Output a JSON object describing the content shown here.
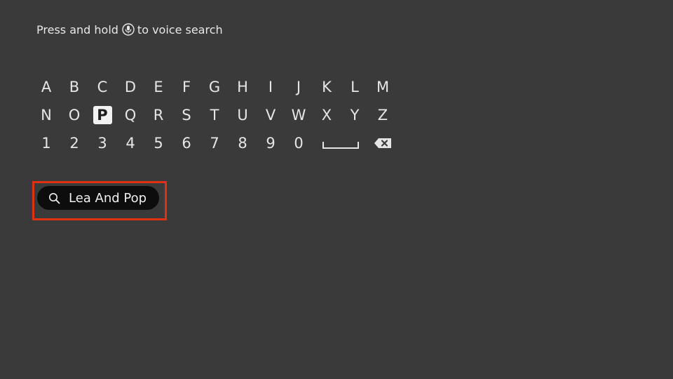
{
  "hint": {
    "prefix": "Press and hold",
    "icon": "microphone-icon",
    "suffix": "to voice search"
  },
  "keyboard": {
    "rows": [
      [
        "A",
        "B",
        "C",
        "D",
        "E",
        "F",
        "G",
        "H",
        "I",
        "J",
        "K",
        "L",
        "M"
      ],
      [
        "N",
        "O",
        "P",
        "Q",
        "R",
        "S",
        "T",
        "U",
        "V",
        "W",
        "X",
        "Y",
        "Z"
      ],
      [
        "1",
        "2",
        "3",
        "4",
        "5",
        "6",
        "7",
        "8",
        "9",
        "0"
      ]
    ],
    "selected_key": "P",
    "special_keys": [
      "space-icon",
      "backspace-icon"
    ]
  },
  "search": {
    "query": "Lea And Pop",
    "icon": "search-icon",
    "highlight_color": "#e03212"
  },
  "colors": {
    "background": "#3a3a3a",
    "pill": "#0d0d0d",
    "selected_key_bg": "#f2f2f2"
  }
}
